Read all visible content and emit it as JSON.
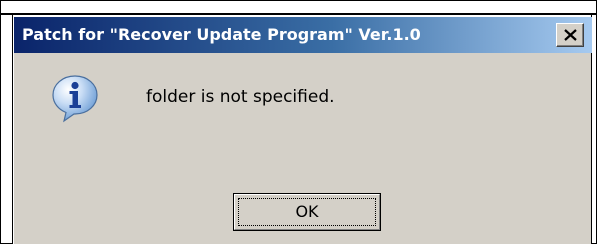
{
  "dialog": {
    "title": "Patch for \"Recover Update Program\" Ver.1.0",
    "close_label": "X",
    "icon": "info-icon",
    "message": "folder is not specified.",
    "ok_label": "OK"
  },
  "colors": {
    "titlebar_start": "#0a246a",
    "titlebar_end": "#a6caf0",
    "dialog_face": "#d4d0c8"
  }
}
